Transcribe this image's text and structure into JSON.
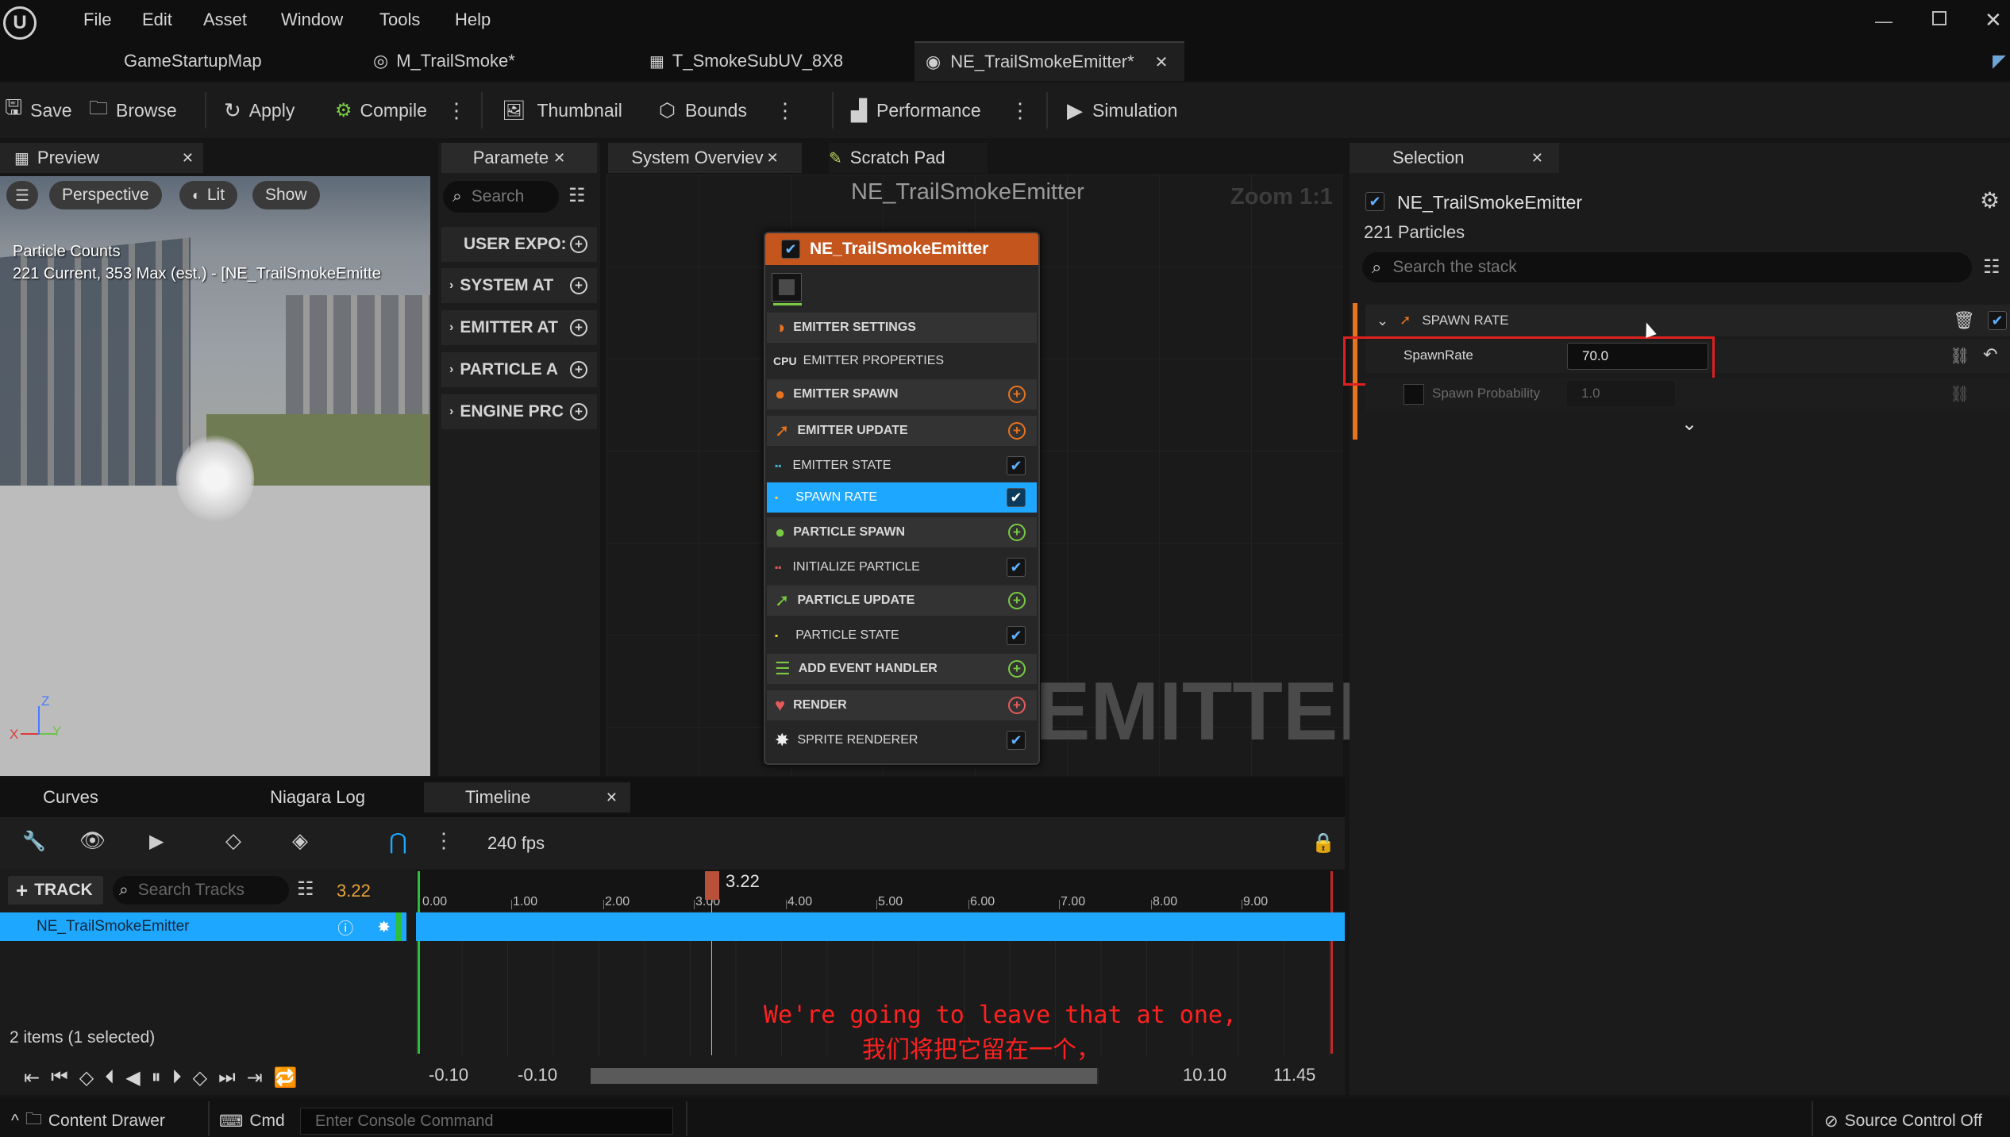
{
  "menu": [
    "File",
    "Edit",
    "Asset",
    "Window",
    "Tools",
    "Help"
  ],
  "doc_tabs": [
    "GameStartupMap",
    "M_TrailSmoke*",
    "T_SmokeSubUV_8X8",
    "NE_TrailSmokeEmitter*"
  ],
  "toolbar": {
    "save": "Save",
    "browse": "Browse",
    "apply": "Apply",
    "compile": "Compile",
    "thumbnail": "Thumbnail",
    "bounds": "Bounds",
    "performance": "Performance",
    "simulation": "Simulation"
  },
  "preview": {
    "tab": "Preview",
    "perspective": "Perspective",
    "lit": "Lit",
    "show": "Show",
    "counts_title": "Particle Counts",
    "counts_text": "221 Current, 353 Max (est.) - [NE_TrailSmokeEmitte",
    "axis_z": "Z",
    "axis_y": "Y",
    "axis_x": "X"
  },
  "params": {
    "tab": "Paramete",
    "search_placeholder": "Search",
    "rows": [
      "USER EXPO:",
      "SYSTEM AT",
      "EMITTER AT",
      "PARTICLE A",
      "ENGINE PRC"
    ]
  },
  "graph": {
    "tab_overview": "System Overviev",
    "tab_scratch": "Scratch Pad",
    "title": "NE_TrailSmokeEmitter",
    "zoom": "Zoom 1:1",
    "watermark": "EMITTER",
    "node_title": "NE_TrailSmokeEmitter",
    "rows": [
      {
        "label": "EMITTER SETTINGS",
        "bold": true
      },
      {
        "label": "EMITTER PROPERTIES",
        "bold": false
      },
      {
        "label": "EMITTER SPAWN",
        "bold": true
      },
      {
        "label": "EMITTER UPDATE",
        "bold": true
      },
      {
        "label": "EMITTER STATE",
        "bold": false
      },
      {
        "label": "SPAWN RATE",
        "bold": false
      },
      {
        "label": "PARTICLE SPAWN",
        "bold": true
      },
      {
        "label": "INITIALIZE PARTICLE",
        "bold": false
      },
      {
        "label": "PARTICLE UPDATE",
        "bold": true
      },
      {
        "label": "PARTICLE STATE",
        "bold": false
      },
      {
        "label": "ADD EVENT HANDLER",
        "bold": true
      },
      {
        "label": "RENDER",
        "bold": true
      },
      {
        "label": "SPRITE RENDERER",
        "bold": false
      }
    ]
  },
  "selection": {
    "tab": "Selection",
    "emitter": "NE_TrailSmokeEmitter",
    "particles": "221 Particles",
    "search_placeholder": "Search the stack",
    "section": "SPAWN RATE",
    "spawnrate_label": "SpawnRate",
    "spawnrate_value": "70.0",
    "prob_label": "Spawn Probability",
    "prob_value": "1.0"
  },
  "bottom_tabs": {
    "curves": "Curves",
    "log": "Niagara Log",
    "timeline": "Timeline"
  },
  "timeline": {
    "fps": "240 fps",
    "track_btn": "TRACK",
    "search_placeholder": "Search Tracks",
    "current_time": "3.22",
    "playhead_label": "3.22",
    "track_name": "NE_TrailSmokeEmitter",
    "ticks": [
      "0.00",
      "1.00",
      "2.00",
      "3.00",
      "4.00",
      "5.00",
      "6.00",
      "7.00",
      "8.00",
      "9.00"
    ],
    "items_status": "2 items (1 selected)",
    "range_start": "-0.10",
    "range_start2": "-0.10",
    "range_end": "10.10",
    "range_end2": "11.45"
  },
  "subtitle": {
    "en": "We're going to leave that at one,",
    "zh": "我们将把它留在一个，"
  },
  "statusbar": {
    "content_drawer": "Content Drawer",
    "cmd": "Cmd",
    "console_placeholder": "Enter Console Command",
    "source_control": "Source Control Off"
  },
  "colors": {
    "accent_blue": "#1ea7ff",
    "orange": "#e8731e",
    "green": "#7ac943",
    "highlight_red": "#e02020"
  }
}
